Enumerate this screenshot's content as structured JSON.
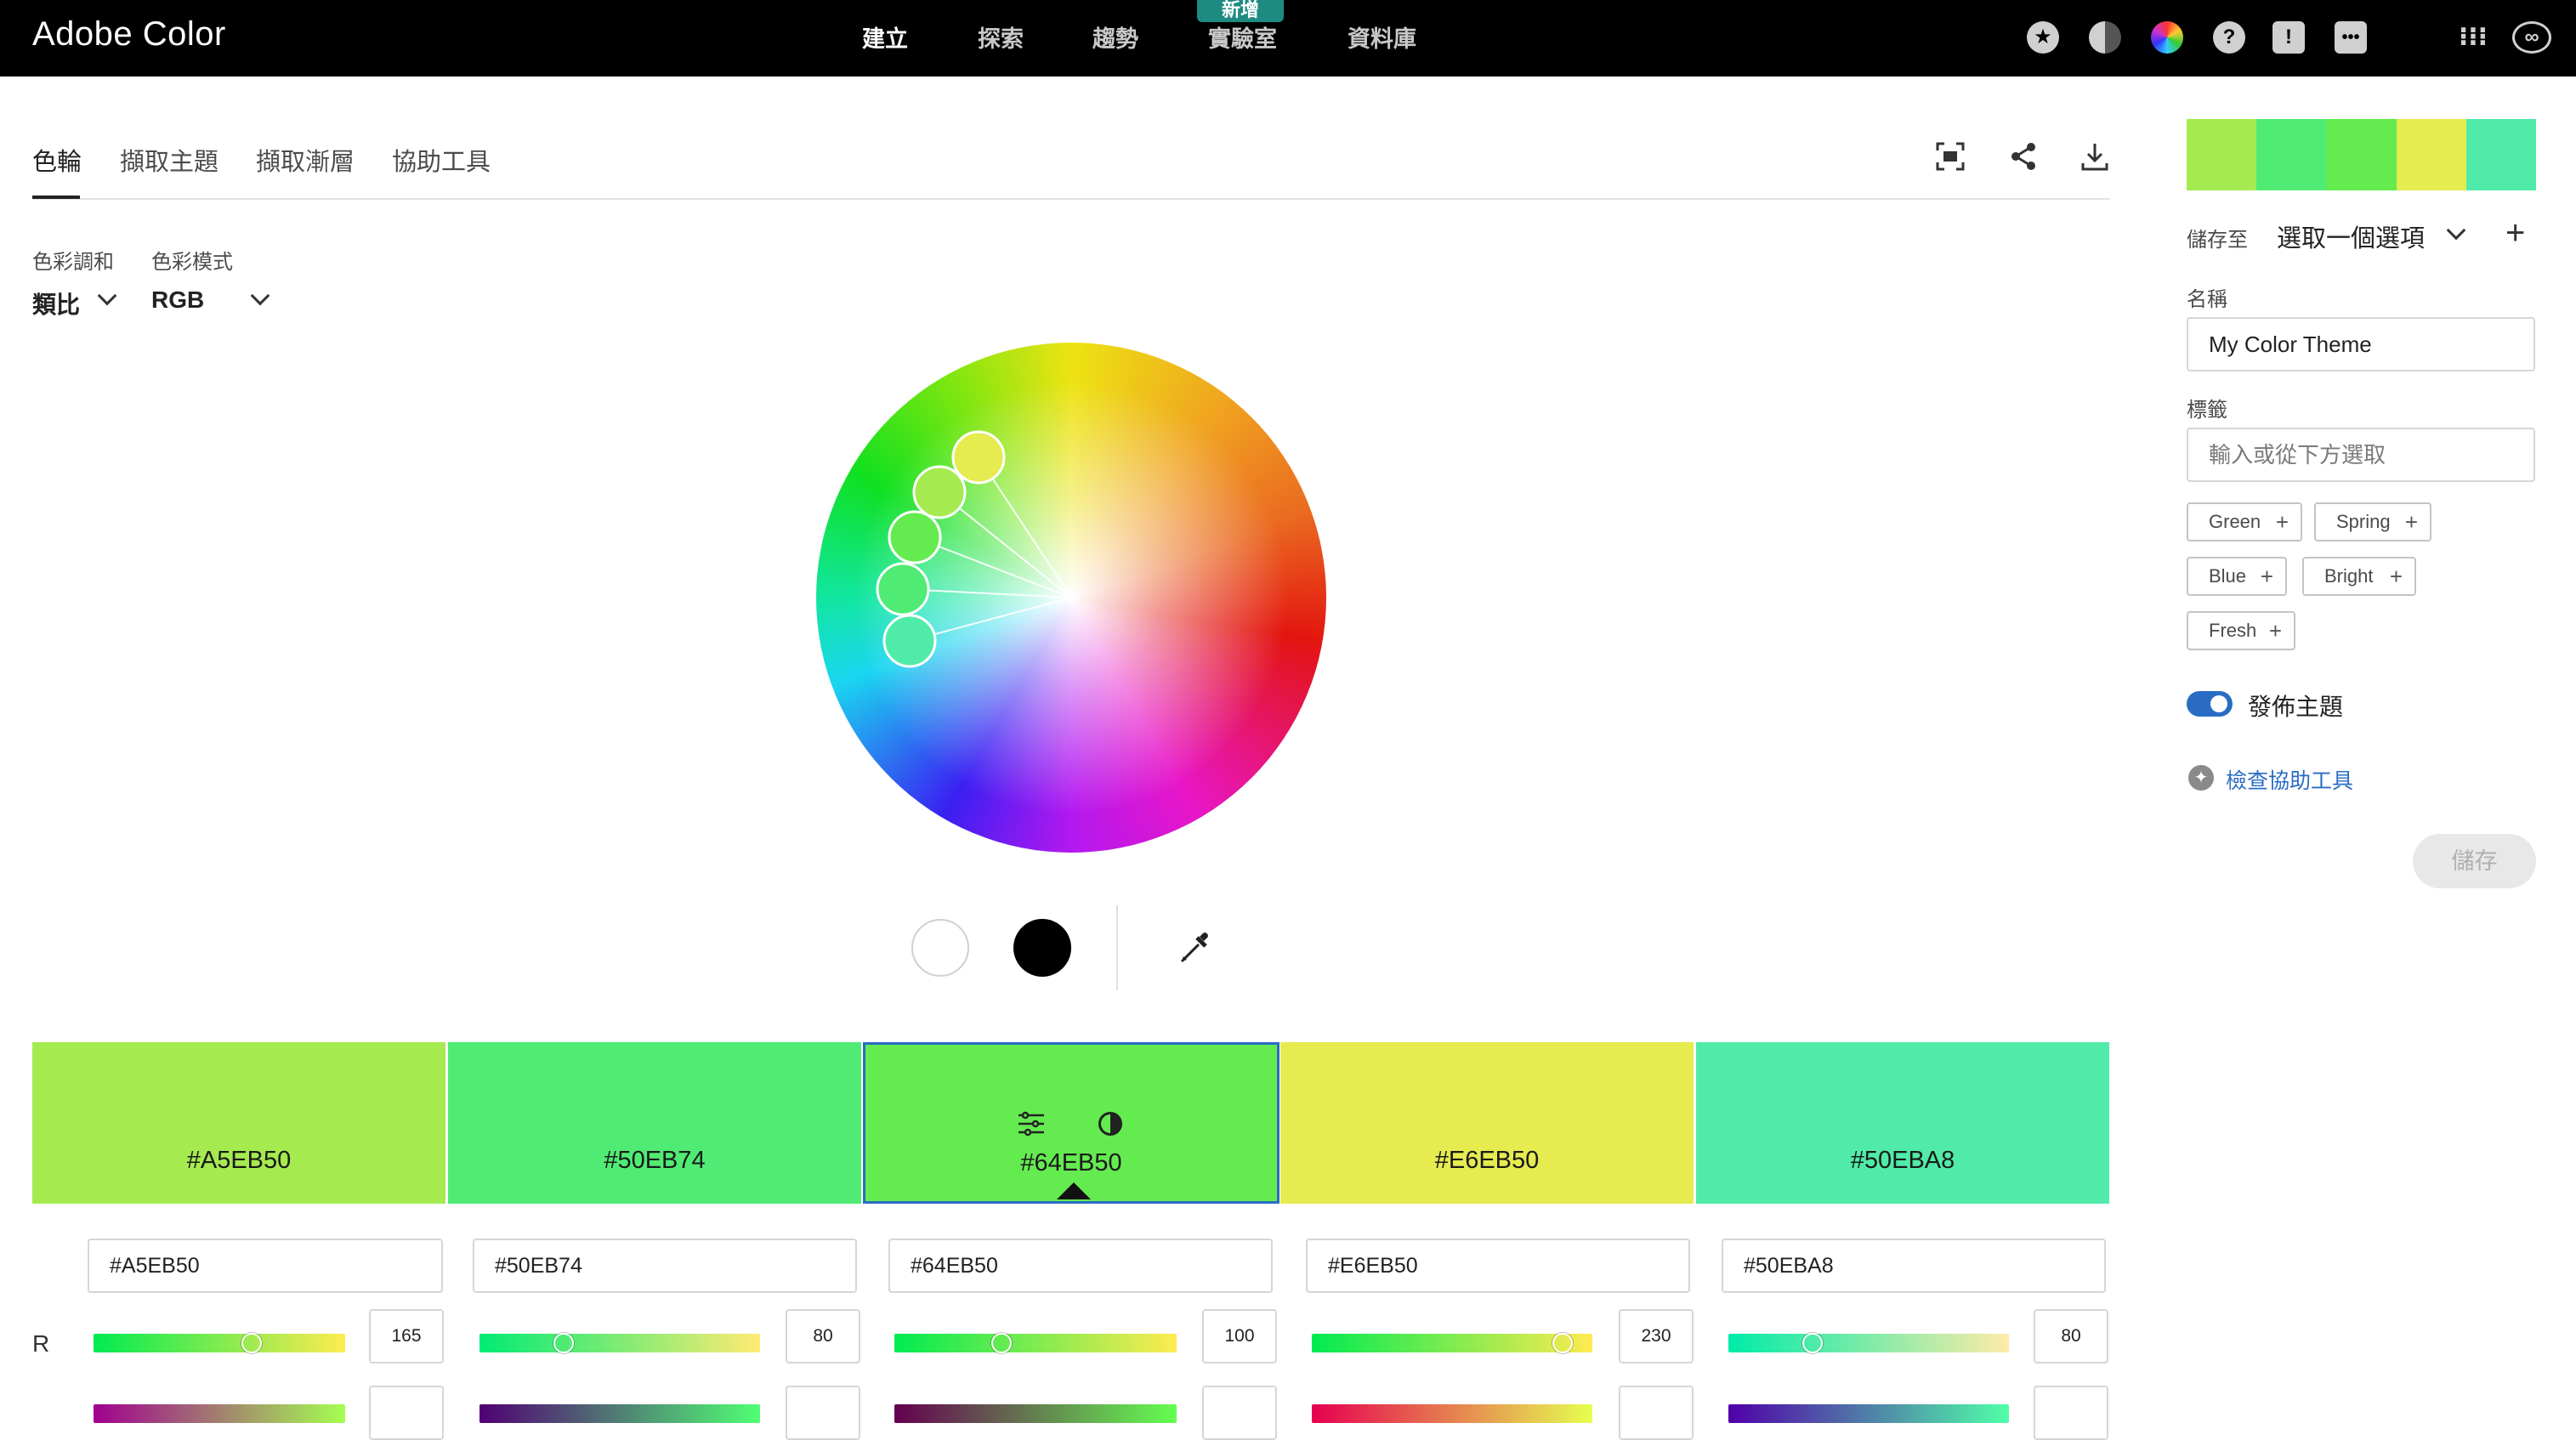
{
  "app": {
    "brand": "Adobe Color",
    "nav": [
      "建立",
      "探索",
      "趨勢",
      "實驗室",
      "資料庫"
    ],
    "nav_badge": "新增",
    "top_icons": [
      "star-icon",
      "contrast-icon",
      "color-wheel-icon",
      "help-icon",
      "feedback-icon",
      "chat-icon",
      "apps-grid-icon",
      "creative-cloud-icon"
    ]
  },
  "tabs": [
    "色輪",
    "擷取主題",
    "擷取漸層",
    "協助工具"
  ],
  "controls": {
    "harmony_label": "色彩調和",
    "harmony_value": "類比",
    "mode_label": "色彩模式",
    "mode_value": "RGB"
  },
  "accent": "#2a6cc4",
  "swatches": [
    {
      "hex": "#A5EB50",
      "r": 165
    },
    {
      "hex": "#50EB74",
      "r": 80
    },
    {
      "hex": "#64EB50",
      "r": 100
    },
    {
      "hex": "#E6EB50",
      "r": 230
    },
    {
      "hex": "#50EBA8",
      "r": 80
    }
  ],
  "channel_label": "R",
  "right_panel": {
    "save_to_label": "儲存至",
    "save_to_value": "選取一個選項",
    "name_label": "名稱",
    "name_value": "My Color Theme",
    "tags_label": "標籤",
    "tags_placeholder": "輸入或從下方選取",
    "tags": [
      "Green",
      "Spring",
      "Blue",
      "Bright",
      "Fresh"
    ],
    "publish_label": "發佈主題",
    "publish_on": true,
    "accessibility_link": "檢查協助工具",
    "save_button": "儲存"
  }
}
